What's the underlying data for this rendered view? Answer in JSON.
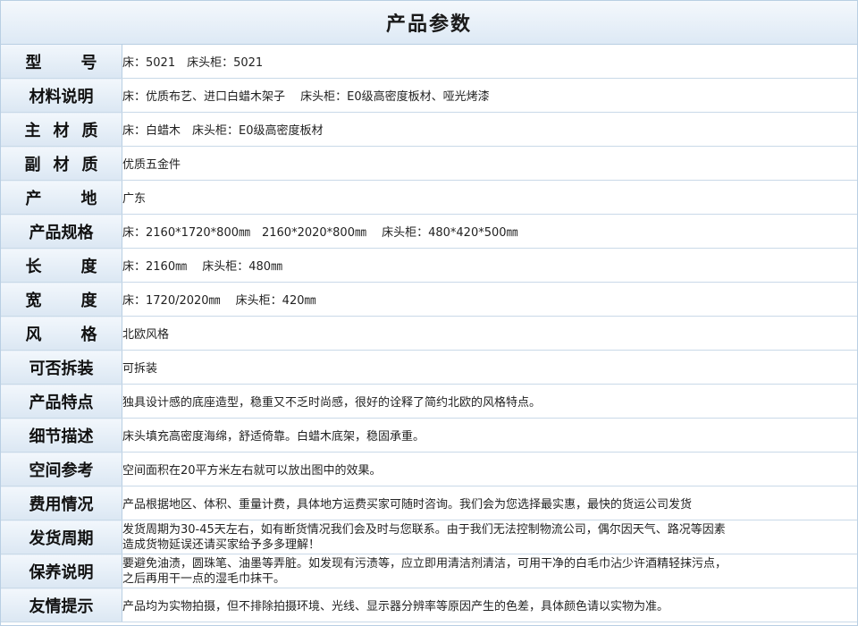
{
  "title": "产品参数",
  "rows": [
    {
      "label": "型号",
      "value": "床：5021　床头柜：5021"
    },
    {
      "label": "材料说明",
      "value": "床：优质布艺、进口白蜡木架子　 床头柜：E0级高密度板材、哑光烤漆"
    },
    {
      "label": "主材质",
      "value": "床：白蜡木　床头柜：E0级高密度板材"
    },
    {
      "label": "副材质",
      "value": "优质五金件"
    },
    {
      "label": "产地",
      "value": "广东"
    },
    {
      "label": "产品规格",
      "value": "床：2160*1720*800㎜　2160*2020*800㎜　 床头柜：480*420*500㎜"
    },
    {
      "label": "长度",
      "value": "床：2160㎜　 床头柜：480㎜"
    },
    {
      "label": "宽度",
      "value": "床：1720/2020㎜　 床头柜：420㎜"
    },
    {
      "label": "风格",
      "value": "北欧风格"
    },
    {
      "label": "可否拆装",
      "value": "可拆装"
    },
    {
      "label": "产品特点",
      "value": "独具设计感的底座造型，稳重又不乏时尚感，很好的诠释了简约北欧的风格特点。"
    },
    {
      "label": "细节描述",
      "value": "床头填充高密度海绵，舒适倚靠。白蜡木底架，稳固承重。"
    },
    {
      "label": "空间参考",
      "value": "空间面积在20平方米左右就可以放出图中的效果。"
    },
    {
      "label": "费用情况",
      "value": "产品根据地区、体积、重量计费，具体地方运费买家可随时咨询。我们会为您选择最实惠，最快的货运公司发货"
    },
    {
      "label": "发货周期",
      "value": "发货周期为30-45天左右，如有断货情况我们会及时与您联系。由于我们无法控制物流公司，偶尔因天气、路况等因素",
      "value2": "造成货物延误还请买家给予多多理解！"
    },
    {
      "label": "保养说明",
      "value": "要避免油渍，圆珠笔、油墨等弄脏。如发现有污渍等，应立即用清洁剂清洁，可用干净的白毛巾沾少许酒精轻抹污点，",
      "value2": "之后再用干一点的湿毛巾抹干。"
    },
    {
      "label": "友情提示",
      "value": "产品均为实物拍摄，但不排除拍摄环境、光线、显示器分辨率等原因产生的色差，具体颜色请以实物为准。"
    }
  ]
}
